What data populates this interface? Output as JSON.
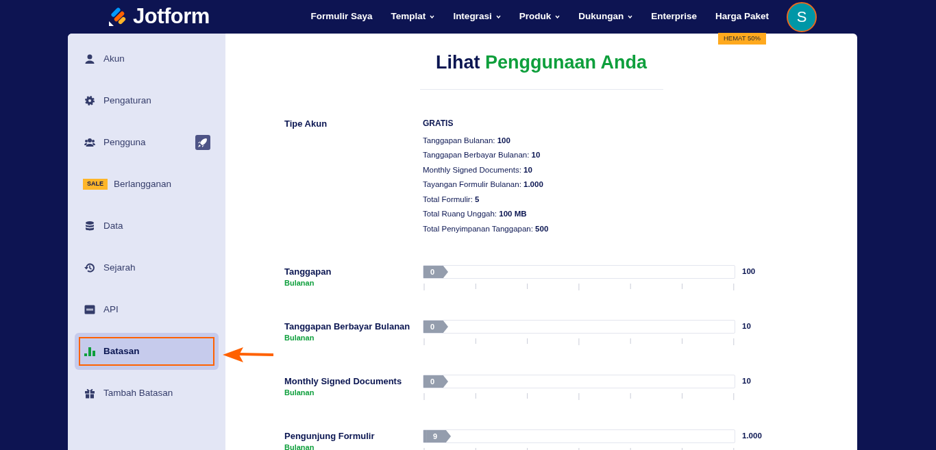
{
  "header": {
    "logo": "Jotform",
    "nav": [
      {
        "label": "Formulir Saya",
        "dropdown": false
      },
      {
        "label": "Templat",
        "dropdown": true
      },
      {
        "label": "Integrasi",
        "dropdown": true
      },
      {
        "label": "Produk",
        "dropdown": true
      },
      {
        "label": "Dukungan",
        "dropdown": true
      },
      {
        "label": "Enterprise",
        "dropdown": false
      },
      {
        "label": "Harga Paket",
        "dropdown": false,
        "ribbon": "HEMAT 50%"
      }
    ],
    "avatar": "S"
  },
  "sidebar": {
    "items": [
      {
        "label": "Akun",
        "kind": "user",
        "selected": false
      },
      {
        "label": "Pengaturan",
        "kind": "gear",
        "selected": false
      },
      {
        "label": "Pengguna",
        "kind": "users",
        "selected": false,
        "upgrade": true
      },
      {
        "label": "Berlangganan",
        "kind": "sale",
        "badge": "SALE",
        "selected": false
      },
      {
        "label": "Data",
        "kind": "database",
        "selected": false
      },
      {
        "label": "Sejarah",
        "kind": "history",
        "selected": false
      },
      {
        "label": "API",
        "kind": "api",
        "selected": false
      },
      {
        "label": "Batasan",
        "kind": "chart",
        "selected": true
      },
      {
        "label": "Tambah Batasan",
        "kind": "gift",
        "selected": false
      }
    ]
  },
  "title": {
    "text": "Lihat",
    "highlight": "Penggunaan Anda"
  },
  "account": {
    "label": "Tipe Akun",
    "plan": "GRATIS",
    "limits": [
      "Tanggapan Bulanan: **100**",
      "Tanggapan Berbayar Bulanan: **10**",
      "Monthly Signed Documents: **10**",
      "Tayangan Formulir Bulanan: **1.000**",
      "Total Formulir: **5**",
      "Total Ruang Unggah: **100 MB**",
      "Total Penyimpanan Tanggapan: **500**"
    ]
  },
  "usage": [
    {
      "name": "Tanggapan",
      "period": "Bulanan",
      "used": "0",
      "limit": "100",
      "level": 0
    },
    {
      "name": "Tanggapan Berbayar Bulanan",
      "period": "Bulanan",
      "used": "0",
      "limit": "10",
      "level": 0
    },
    {
      "name": "Monthly Signed Documents",
      "period": "Bulanan",
      "used": "0",
      "limit": "10",
      "level": 0
    },
    {
      "name": "Pengunjung Formulir",
      "period": "Bulanan",
      "used": "9",
      "limit": "1.000",
      "level": 0.009
    }
  ]
}
